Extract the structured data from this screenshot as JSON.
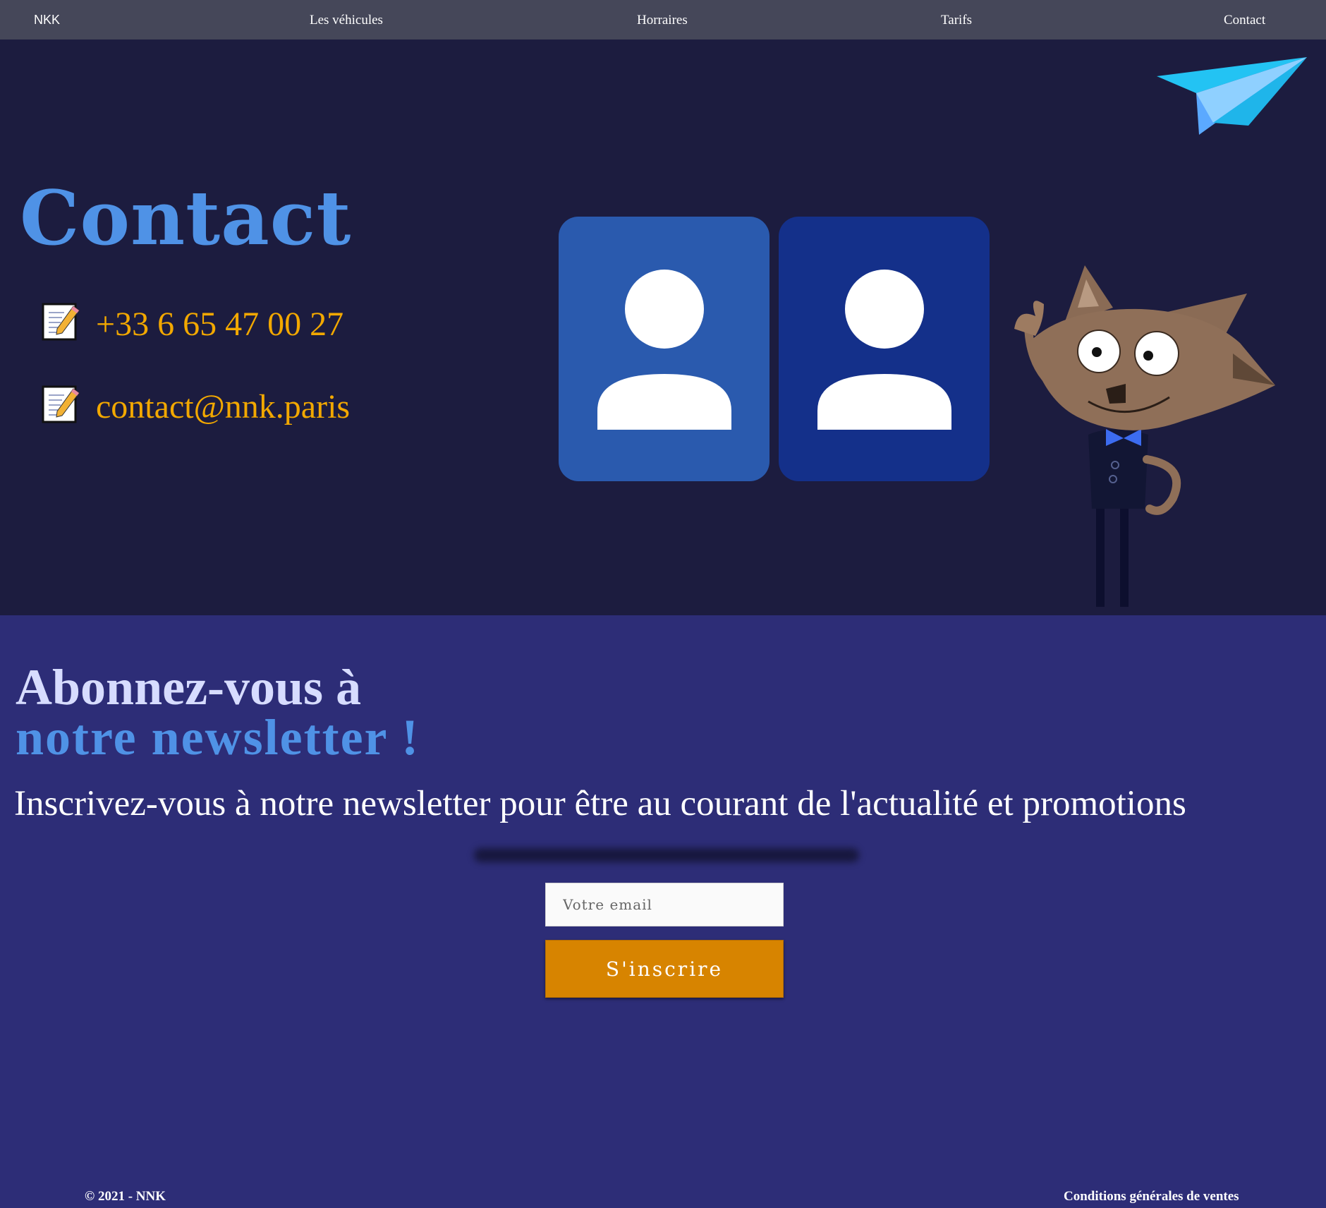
{
  "nav": {
    "brand": "NKK",
    "items": [
      {
        "label": "Les véhicules"
      },
      {
        "label": "Horraires"
      },
      {
        "label": "Tarifs"
      },
      {
        "label": "Contact"
      }
    ]
  },
  "hero": {
    "title": "Contact",
    "phone": "+33 6 65 47 00 27",
    "email": "contact@nnk.paris",
    "contact_icon": "memo-pencil-icon",
    "cards": [
      {
        "color": "#2a5aae",
        "icon": "user-avatar-icon"
      },
      {
        "color": "#14308a",
        "icon": "user-avatar-icon"
      }
    ],
    "decor": [
      "paper-plane-icon",
      "cat-mascot-icon"
    ]
  },
  "newsletter": {
    "heading_line1": "Abonnez-vous à",
    "heading_line2": "notre newsletter !",
    "subtitle": "Inscrivez-vous à notre newsletter pour être au courant de l'actualité et promotions",
    "email_placeholder": "Votre email",
    "submit_label": "S'inscrire"
  },
  "footer": {
    "copyright": "© 2021 - NNK",
    "terms_link": "Conditions générales de ventes"
  },
  "colors": {
    "nav_bg": "#454759",
    "hero_bg": "#1c1c3f",
    "newsletter_bg": "#2d2d77",
    "accent_blue": "#4f92e6",
    "accent_orange": "#f2a800",
    "button": "#d78400"
  }
}
